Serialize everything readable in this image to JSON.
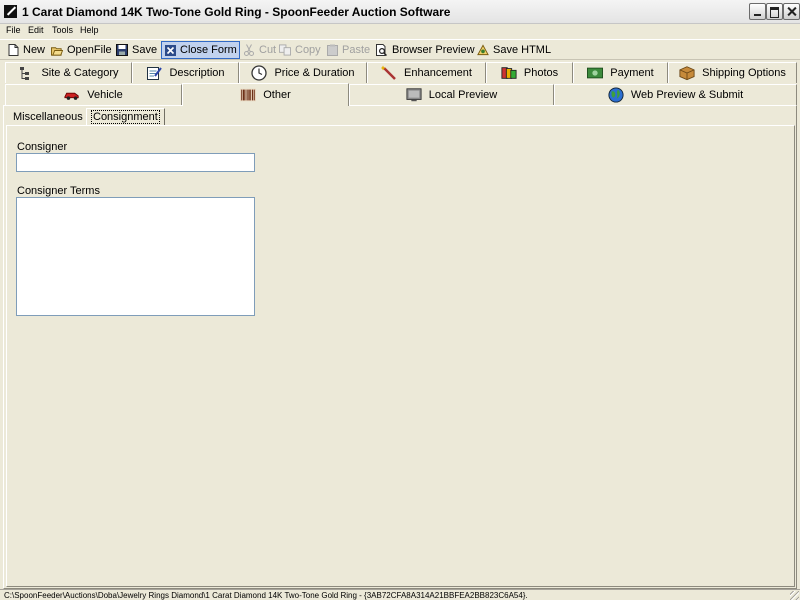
{
  "window": {
    "title": "1 Carat Diamond 14K Two-Tone Gold Ring - SpoonFeeder Auction Software"
  },
  "menubar": {
    "items": [
      "File",
      "Edit",
      "Tools",
      "Help"
    ]
  },
  "toolbar": {
    "new_label": "New",
    "openfile_label": "OpenFile",
    "save_label": "Save",
    "closeform_label": "Close Form",
    "cut_label": "Cut",
    "copy_label": "Copy",
    "paste_label": "Paste",
    "browserpreview_label": "Browser Preview",
    "savehtml_label": "Save HTML"
  },
  "tabs": {
    "row1": [
      {
        "label": "Site & Category",
        "icon": "site-category-icon"
      },
      {
        "label": "Description",
        "icon": "description-icon"
      },
      {
        "label": "Price & Duration",
        "icon": "clock-icon"
      },
      {
        "label": "Enhancement",
        "icon": "wand-icon"
      },
      {
        "label": "Photos",
        "icon": "photos-icon"
      },
      {
        "label": "Payment",
        "icon": "payment-icon"
      },
      {
        "label": "Shipping Options",
        "icon": "package-icon"
      }
    ],
    "row2": [
      {
        "label": "Vehicle",
        "icon": "car-icon"
      },
      {
        "label": "Other",
        "icon": "barcode-icon",
        "selected": true
      },
      {
        "label": "Local Preview",
        "icon": "monitor-icon"
      },
      {
        "label": "Web Preview & Submit",
        "icon": "globe-icon"
      }
    ]
  },
  "subtabs": [
    {
      "label": "Miscellaneous"
    },
    {
      "label": "Consignment",
      "selected": true
    }
  ],
  "form": {
    "consigner_label": "Consigner",
    "consigner_value": "",
    "terms_label": "Consigner Terms",
    "terms_value": ""
  },
  "statusbar": {
    "path": "C:\\SpoonFeeder\\Auctions\\Doba\\Jewelry Rings Diamond\\1 Carat Diamond 14K Two-Tone Gold Ring - {3AB72CFA8A314A21BBFEA2BB823C6A54}."
  },
  "colors": {
    "window_bg": "#ece9d8",
    "field_border": "#7f9db9",
    "active_button_bg": "#c1d2ee"
  }
}
